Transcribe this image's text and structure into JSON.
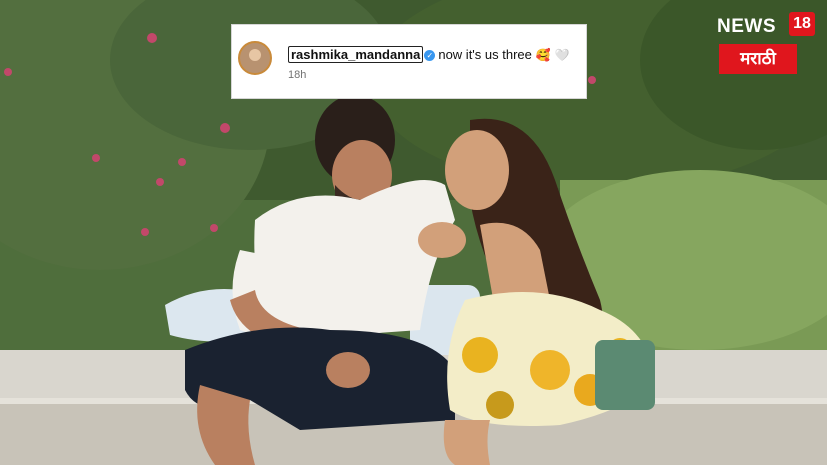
{
  "comment": {
    "username": "rashmika_mandanna",
    "text": "now it's us three",
    "emoji": "🥰 🤍",
    "time": "18h"
  },
  "logo": {
    "top": "NEWS",
    "badge": "18",
    "bottom": "मराठी"
  },
  "colors": {
    "logo_red": "#e0161d",
    "verified_blue": "#3897f0"
  }
}
